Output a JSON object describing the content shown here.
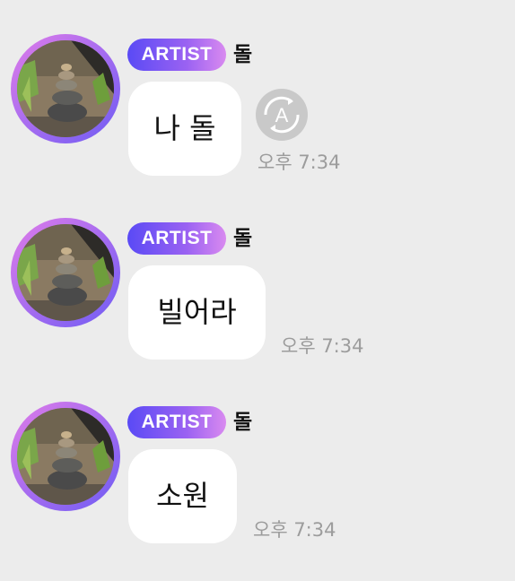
{
  "messages": [
    {
      "badge": "ARTIST",
      "sender": "돌",
      "text": "나 돌",
      "time": "오후 7:34",
      "has_translate_button": true,
      "translate_glyph": "A"
    },
    {
      "badge": "ARTIST",
      "sender": "돌",
      "text": "빌어라",
      "time": "오후 7:34"
    },
    {
      "badge": "ARTIST",
      "sender": "돌",
      "text": "소원",
      "time": "오후 7:34"
    }
  ],
  "icons": {
    "translate": "auto-translate-icon",
    "avatar": "stone-stack-avatar"
  },
  "colors": {
    "background": "#ececec",
    "bubble": "#ffffff",
    "badge_start": "#5a4af5",
    "badge_end": "#d98af0",
    "time_text": "#9c9c9c"
  }
}
